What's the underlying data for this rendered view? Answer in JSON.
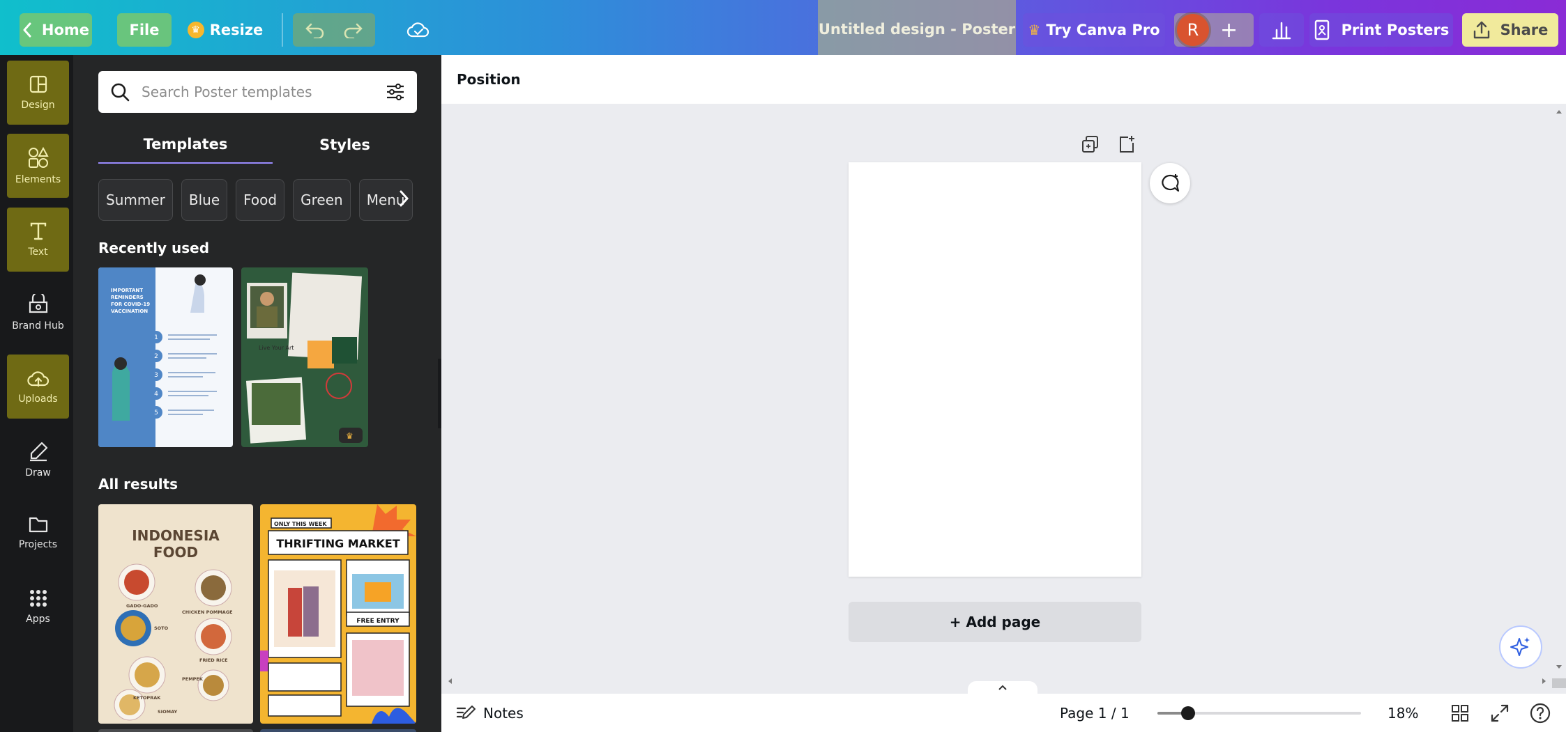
{
  "topbar": {
    "home_label": "Home",
    "file_label": "File",
    "resize_label": "Resize",
    "doc_title": "Untitled design - Poster",
    "pro_label": "Try Canva Pro",
    "avatar_initial": "R",
    "add_label": "+",
    "print_label": "Print Posters",
    "share_label": "Share"
  },
  "rail": {
    "items": [
      {
        "label": "Design",
        "icon": "design-icon"
      },
      {
        "label": "Elements",
        "icon": "elements-icon"
      },
      {
        "label": "Text",
        "icon": "text-icon"
      },
      {
        "label": "Brand Hub",
        "icon": "brand-hub-icon"
      },
      {
        "label": "Uploads",
        "icon": "upload-cloud-icon"
      },
      {
        "label": "Draw",
        "icon": "pen-icon"
      },
      {
        "label": "Projects",
        "icon": "folder-icon"
      },
      {
        "label": "Apps",
        "icon": "grid-icon"
      }
    ]
  },
  "panel": {
    "search_placeholder": "Search Poster templates",
    "tabs": [
      "Templates",
      "Styles"
    ],
    "chips": [
      "Summer",
      "Blue",
      "Food",
      "Green",
      "Menu"
    ],
    "recent_heading": "Recently used",
    "all_heading": "All results",
    "thumb1": {
      "lines": [
        "IMPORTANT",
        "REMINDERS",
        "FOR COVID-19",
        "VACCINATION"
      ],
      "steps": [
        "1",
        "2",
        "3",
        "4",
        "5"
      ]
    },
    "thumb2": {
      "lines": [
        "Live Your Art"
      ]
    },
    "thumb3": {
      "title1": "INDONESIA",
      "title2": "FOOD",
      "items": [
        "GADO-GADO",
        "CHICKEN POMMAGE",
        "SOTO",
        "FRIED RICE",
        "KETOPRAK",
        "PEMPEK",
        "SIOMAY"
      ]
    },
    "thumb4": {
      "tag": "ONLY THIS WEEK",
      "title": "THRIFTING MARKET",
      "badge": "FREE ENTRY"
    }
  },
  "canvas": {
    "position_label": "Position",
    "add_page_label": "+ Add page"
  },
  "footer": {
    "notes_label": "Notes",
    "page_indicator": "Page 1 / 1",
    "zoom_label": "18%",
    "zoom_level": 0.15
  },
  "colors": {
    "rail_highlight": "#6f6a14",
    "panel_bg": "#252627",
    "accent": "#9b8cff"
  }
}
